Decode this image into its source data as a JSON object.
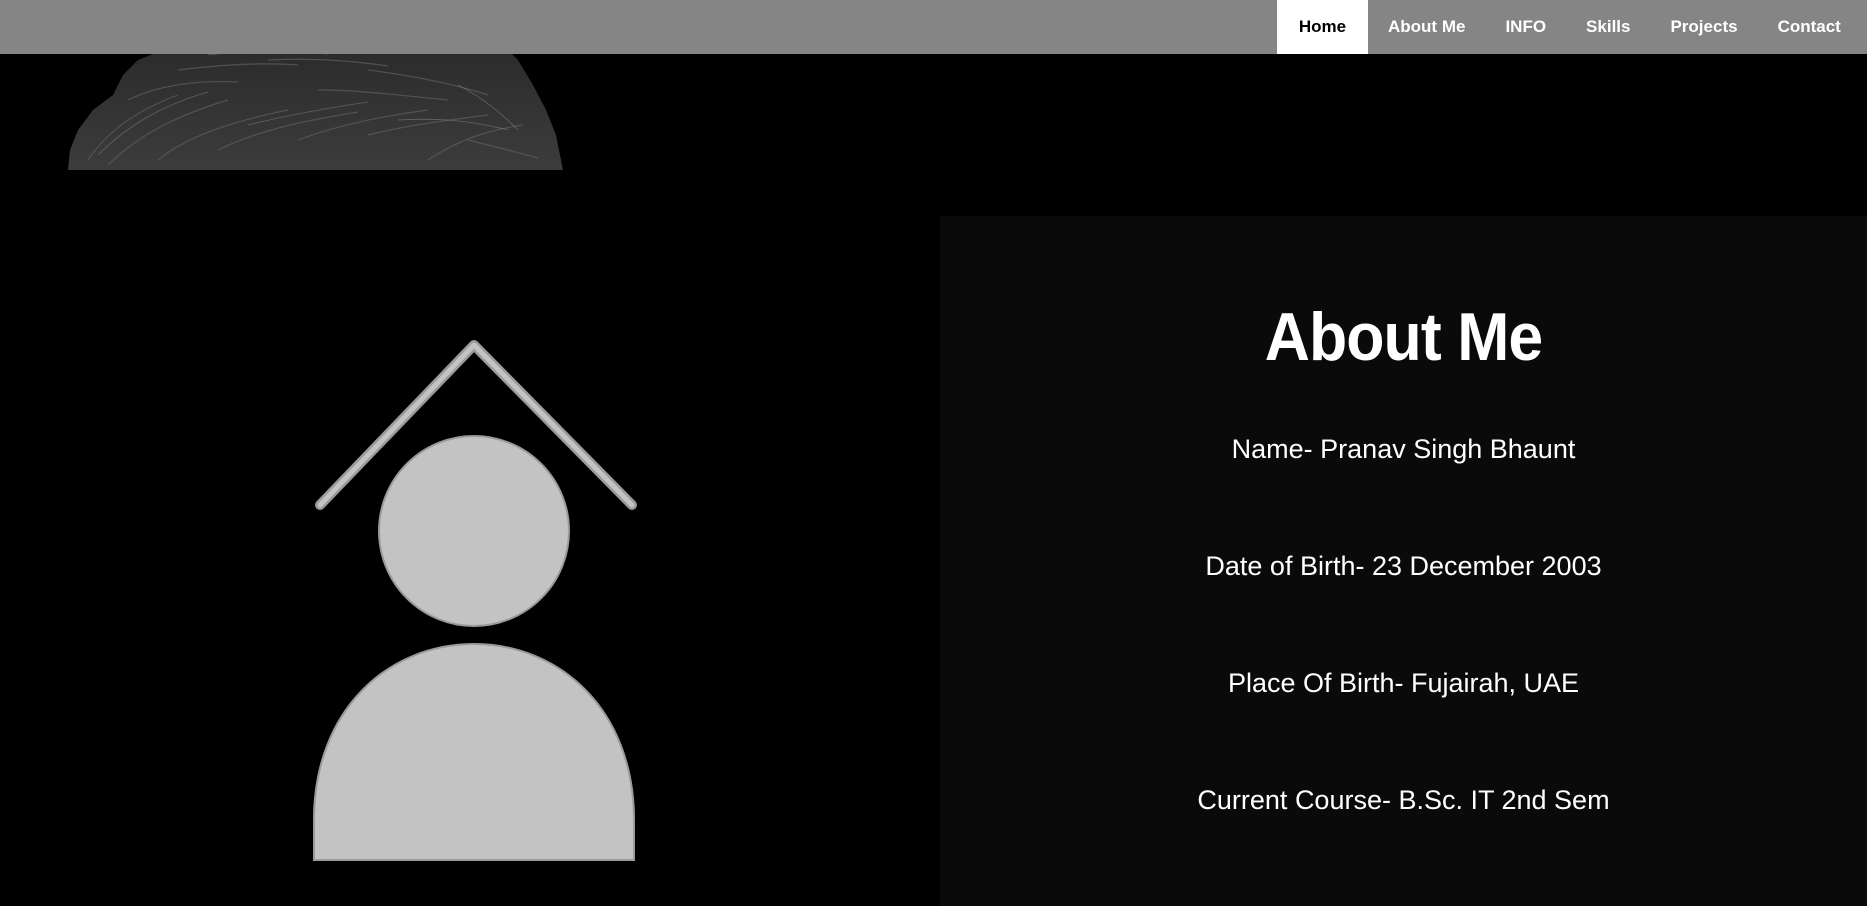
{
  "nav": {
    "items": [
      {
        "label": "Home",
        "active": true
      },
      {
        "label": "About Me",
        "active": false
      },
      {
        "label": "INFO",
        "active": false
      },
      {
        "label": "Skills",
        "active": false
      },
      {
        "label": "Projects",
        "active": false
      },
      {
        "label": "Contact",
        "active": false
      }
    ]
  },
  "about": {
    "title": "About Me",
    "name": "Name- Pranav Singh Bhaunt",
    "dob": "Date of Birth- 23 December 2003",
    "place_of_birth": "Place Of Birth- Fujairah, UAE",
    "course": "Current Course- B.Sc. IT 2nd Sem"
  },
  "images": {
    "profile_photo": "profile-photo",
    "graduate_icon": "graduate-avatar-icon"
  },
  "colors": {
    "navbar_bg": "#858585",
    "nav_active_bg": "#ffffff",
    "nav_text": "#ffffff",
    "page_bg": "#000000",
    "panel_bg": "#0b0a0b",
    "icon_fill": "#c3c3c3"
  }
}
